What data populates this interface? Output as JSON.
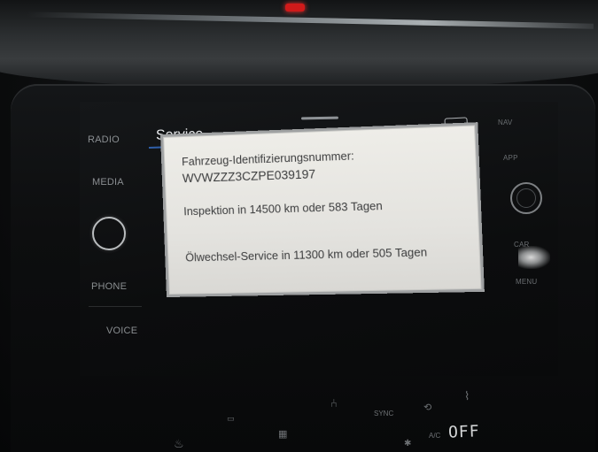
{
  "screen": {
    "title": "Service",
    "back_icon": "↶",
    "vin_label": "Fahrzeug-Identifizierungsnummer:",
    "vin_value": "WVWZZZ3CZPE039197",
    "inspection": "Inspektion in 14500 km oder 583 Tagen",
    "oil_service": "Ölwechsel-Service in 11300 km oder 505 Tagen"
  },
  "hardware_buttons": {
    "radio": "RADIO",
    "media": "MEDIA",
    "phone": "PHONE",
    "voice": "VOICE",
    "nav": "NAV",
    "app": "APP",
    "car": "CAR",
    "menu": "MENU"
  },
  "climate": {
    "sync": "SYNC",
    "ac": "A/C",
    "temperature_display": "OFF"
  },
  "colors": {
    "accent_line": "#2f5ea8",
    "panel_background": "#eeede8"
  }
}
